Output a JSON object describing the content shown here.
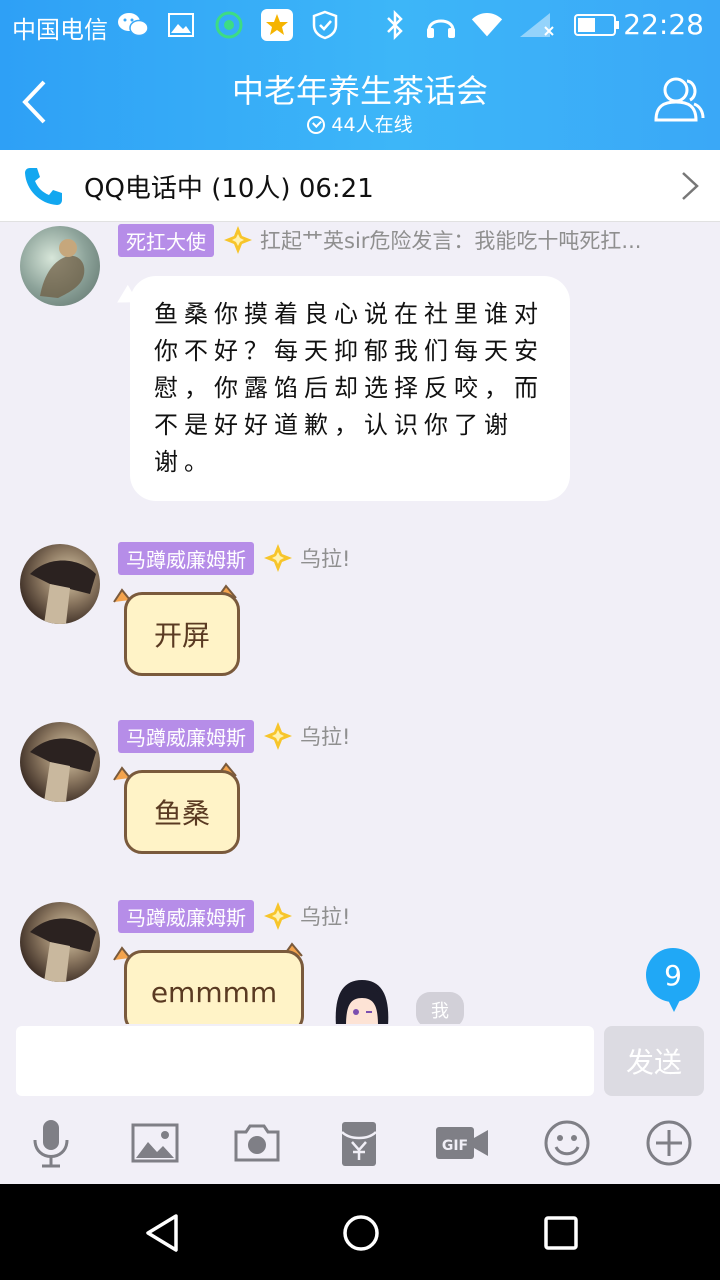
{
  "status_bar": {
    "carrier": "中国电信",
    "time": "22:28",
    "icons": [
      "wechat-icon",
      "gallery-icon",
      "app-icon",
      "star-app-icon",
      "vpn-icon",
      "bluetooth-icon",
      "headphones-icon",
      "wifi-icon",
      "signal-icon",
      "battery-icon"
    ]
  },
  "header": {
    "title": "中老年养生茶话会",
    "online": "44人在线"
  },
  "call_bar": {
    "text": "QQ电话中 (10人)  06:21"
  },
  "messages": [
    {
      "tag": "死扛大使",
      "nickname": "扛起艹英sir危险发言：我能吃十吨死扛...",
      "text": "鱼桑你摸着良心说在社里谁对你不好？每天抑郁我们每天安慰，你露馅后却选择反咬，而不是好好道歉，认识你了谢谢。"
    },
    {
      "tag": "马蹲威廉姆斯",
      "nickname": "乌拉!",
      "text": "开屏"
    },
    {
      "tag": "马蹲威廉姆斯",
      "nickname": "乌拉!",
      "text": "鱼桑"
    },
    {
      "tag": "马蹲威廉姆斯",
      "nickname": "乌拉!",
      "text": "emmmm"
    }
  ],
  "unread_badge": "9",
  "me_label": "我",
  "input": {
    "value": "",
    "send_label": "发送"
  },
  "toolbar": [
    "mic-icon",
    "image-icon",
    "camera-icon",
    "red-packet-icon",
    "gif-icon",
    "emoji-icon",
    "plus-icon"
  ],
  "colors": {
    "header_blue": "#3aa8f7",
    "tag_purple": "#b68de8",
    "badge_blue": "#20a8f6",
    "chat_bg": "#f1eff7"
  }
}
